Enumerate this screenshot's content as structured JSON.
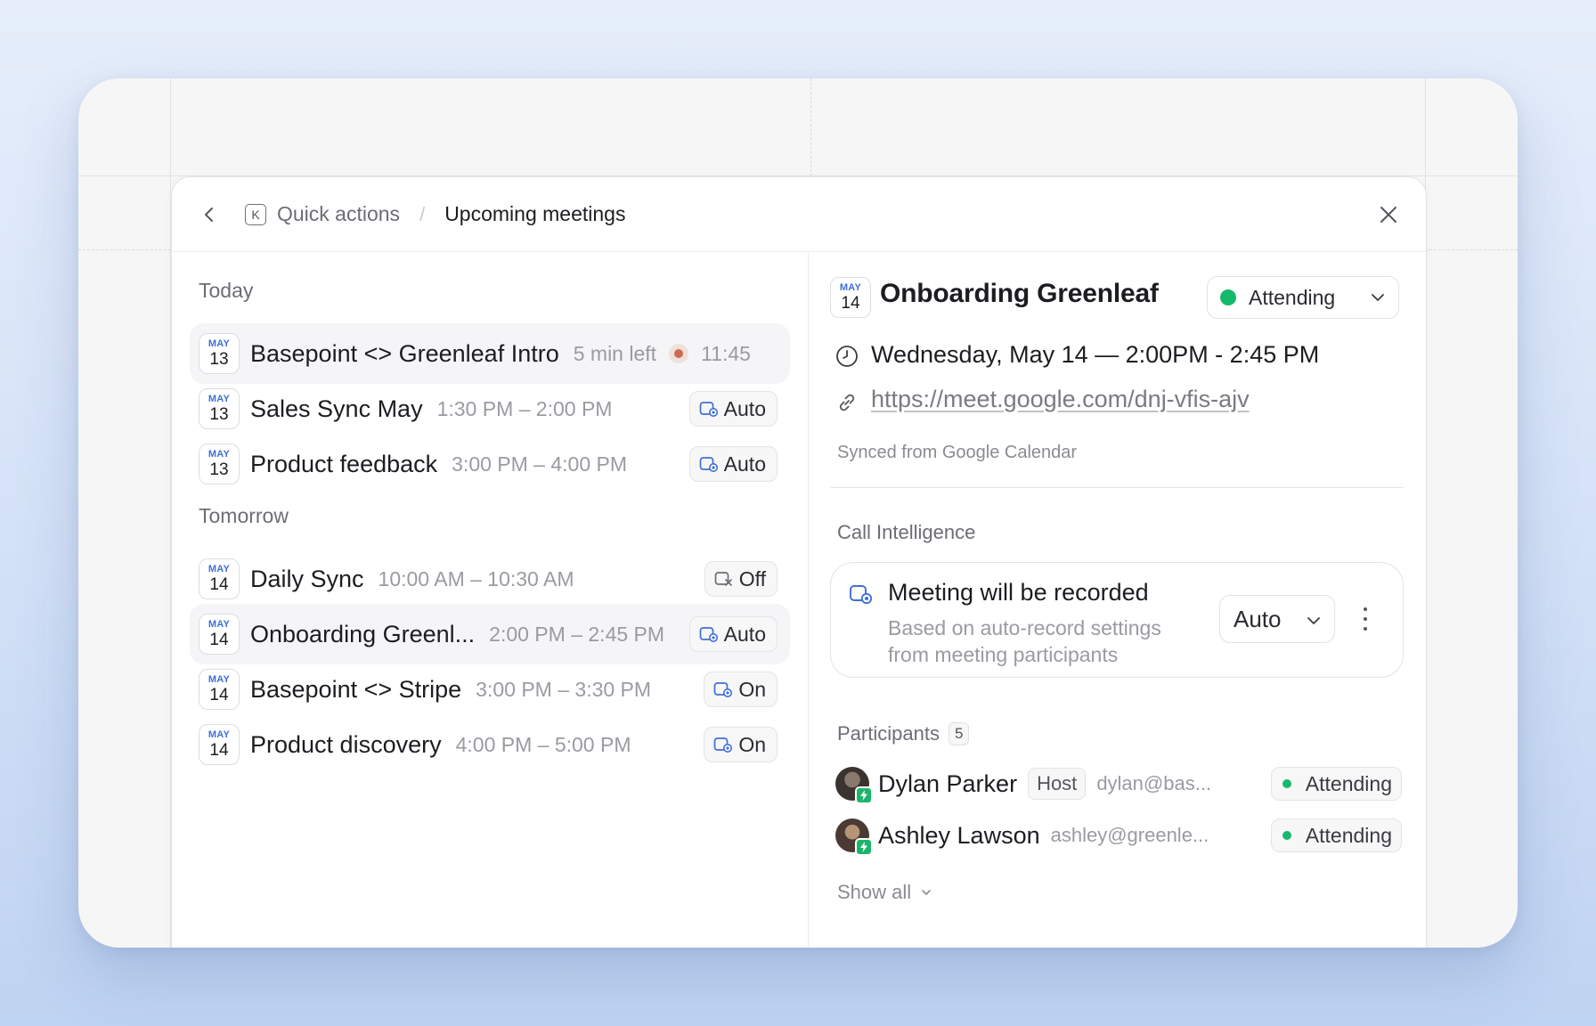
{
  "breadcrumb": {
    "shortcut_key": "K",
    "parent": "Quick actions",
    "separator": "/",
    "current": "Upcoming meetings"
  },
  "list": {
    "today_label": "Today",
    "tomorrow_label": "Tomorrow",
    "today": [
      {
        "month": "MAY",
        "day": "13",
        "title": "Basepoint <> Greenleaf Intro",
        "time": "5 min left",
        "live_time": "11:45",
        "live": true
      },
      {
        "month": "MAY",
        "day": "13",
        "title": "Sales Sync May",
        "time": "1:30 PM – 2:00 PM",
        "record": "Auto"
      },
      {
        "month": "MAY",
        "day": "13",
        "title": "Product feedback",
        "time": "3:00 PM – 4:00 PM",
        "record": "Auto"
      }
    ],
    "tomorrow": [
      {
        "month": "MAY",
        "day": "14",
        "title": "Daily Sync",
        "time": "10:00 AM – 10:30 AM",
        "record": "Off"
      },
      {
        "month": "MAY",
        "day": "14",
        "title": "Onboarding Greenl...",
        "time": "2:00 PM – 2:45 PM",
        "record": "Auto",
        "selected": true
      },
      {
        "month": "MAY",
        "day": "14",
        "title": "Basepoint <> Stripe",
        "time": "3:00 PM – 3:30 PM",
        "record": "On"
      },
      {
        "month": "MAY",
        "day": "14",
        "title": "Product discovery",
        "time": "4:00 PM – 5:00 PM",
        "record": "On"
      }
    ]
  },
  "detail": {
    "month": "MAY",
    "day": "14",
    "title": "Onboarding Greenleaf",
    "status": "Attending",
    "status_color": "#16b96b",
    "when": "Wednesday, May 14 — 2:00PM - 2:45 PM",
    "link": "https://meet.google.com/dnj-vfis-ajv",
    "synced": "Synced from Google Calendar",
    "ci_label": "Call Intelligence",
    "record_title": "Meeting will be recorded",
    "record_sub": "Based on auto-record settings from meeting participants",
    "record_mode": "Auto",
    "participants_label": "Participants",
    "participants_count": "5",
    "participants": [
      {
        "name": "Dylan Parker",
        "tag": "Host",
        "email": "dylan@bas...",
        "status": "Attending"
      },
      {
        "name": "Ashley Lawson",
        "email": "ashley@greenle...",
        "status": "Attending"
      }
    ],
    "show_all": "Show all"
  },
  "colors": {
    "accent": "#3f6fd6",
    "live": "#cc6a4f",
    "attending": "#16b96b"
  },
  "icons": [
    "chevron-left-icon",
    "close-icon",
    "clock-icon",
    "link-icon",
    "record-camera-icon",
    "chevron-down-icon",
    "more-vertical-icon",
    "bolt-icon"
  ]
}
